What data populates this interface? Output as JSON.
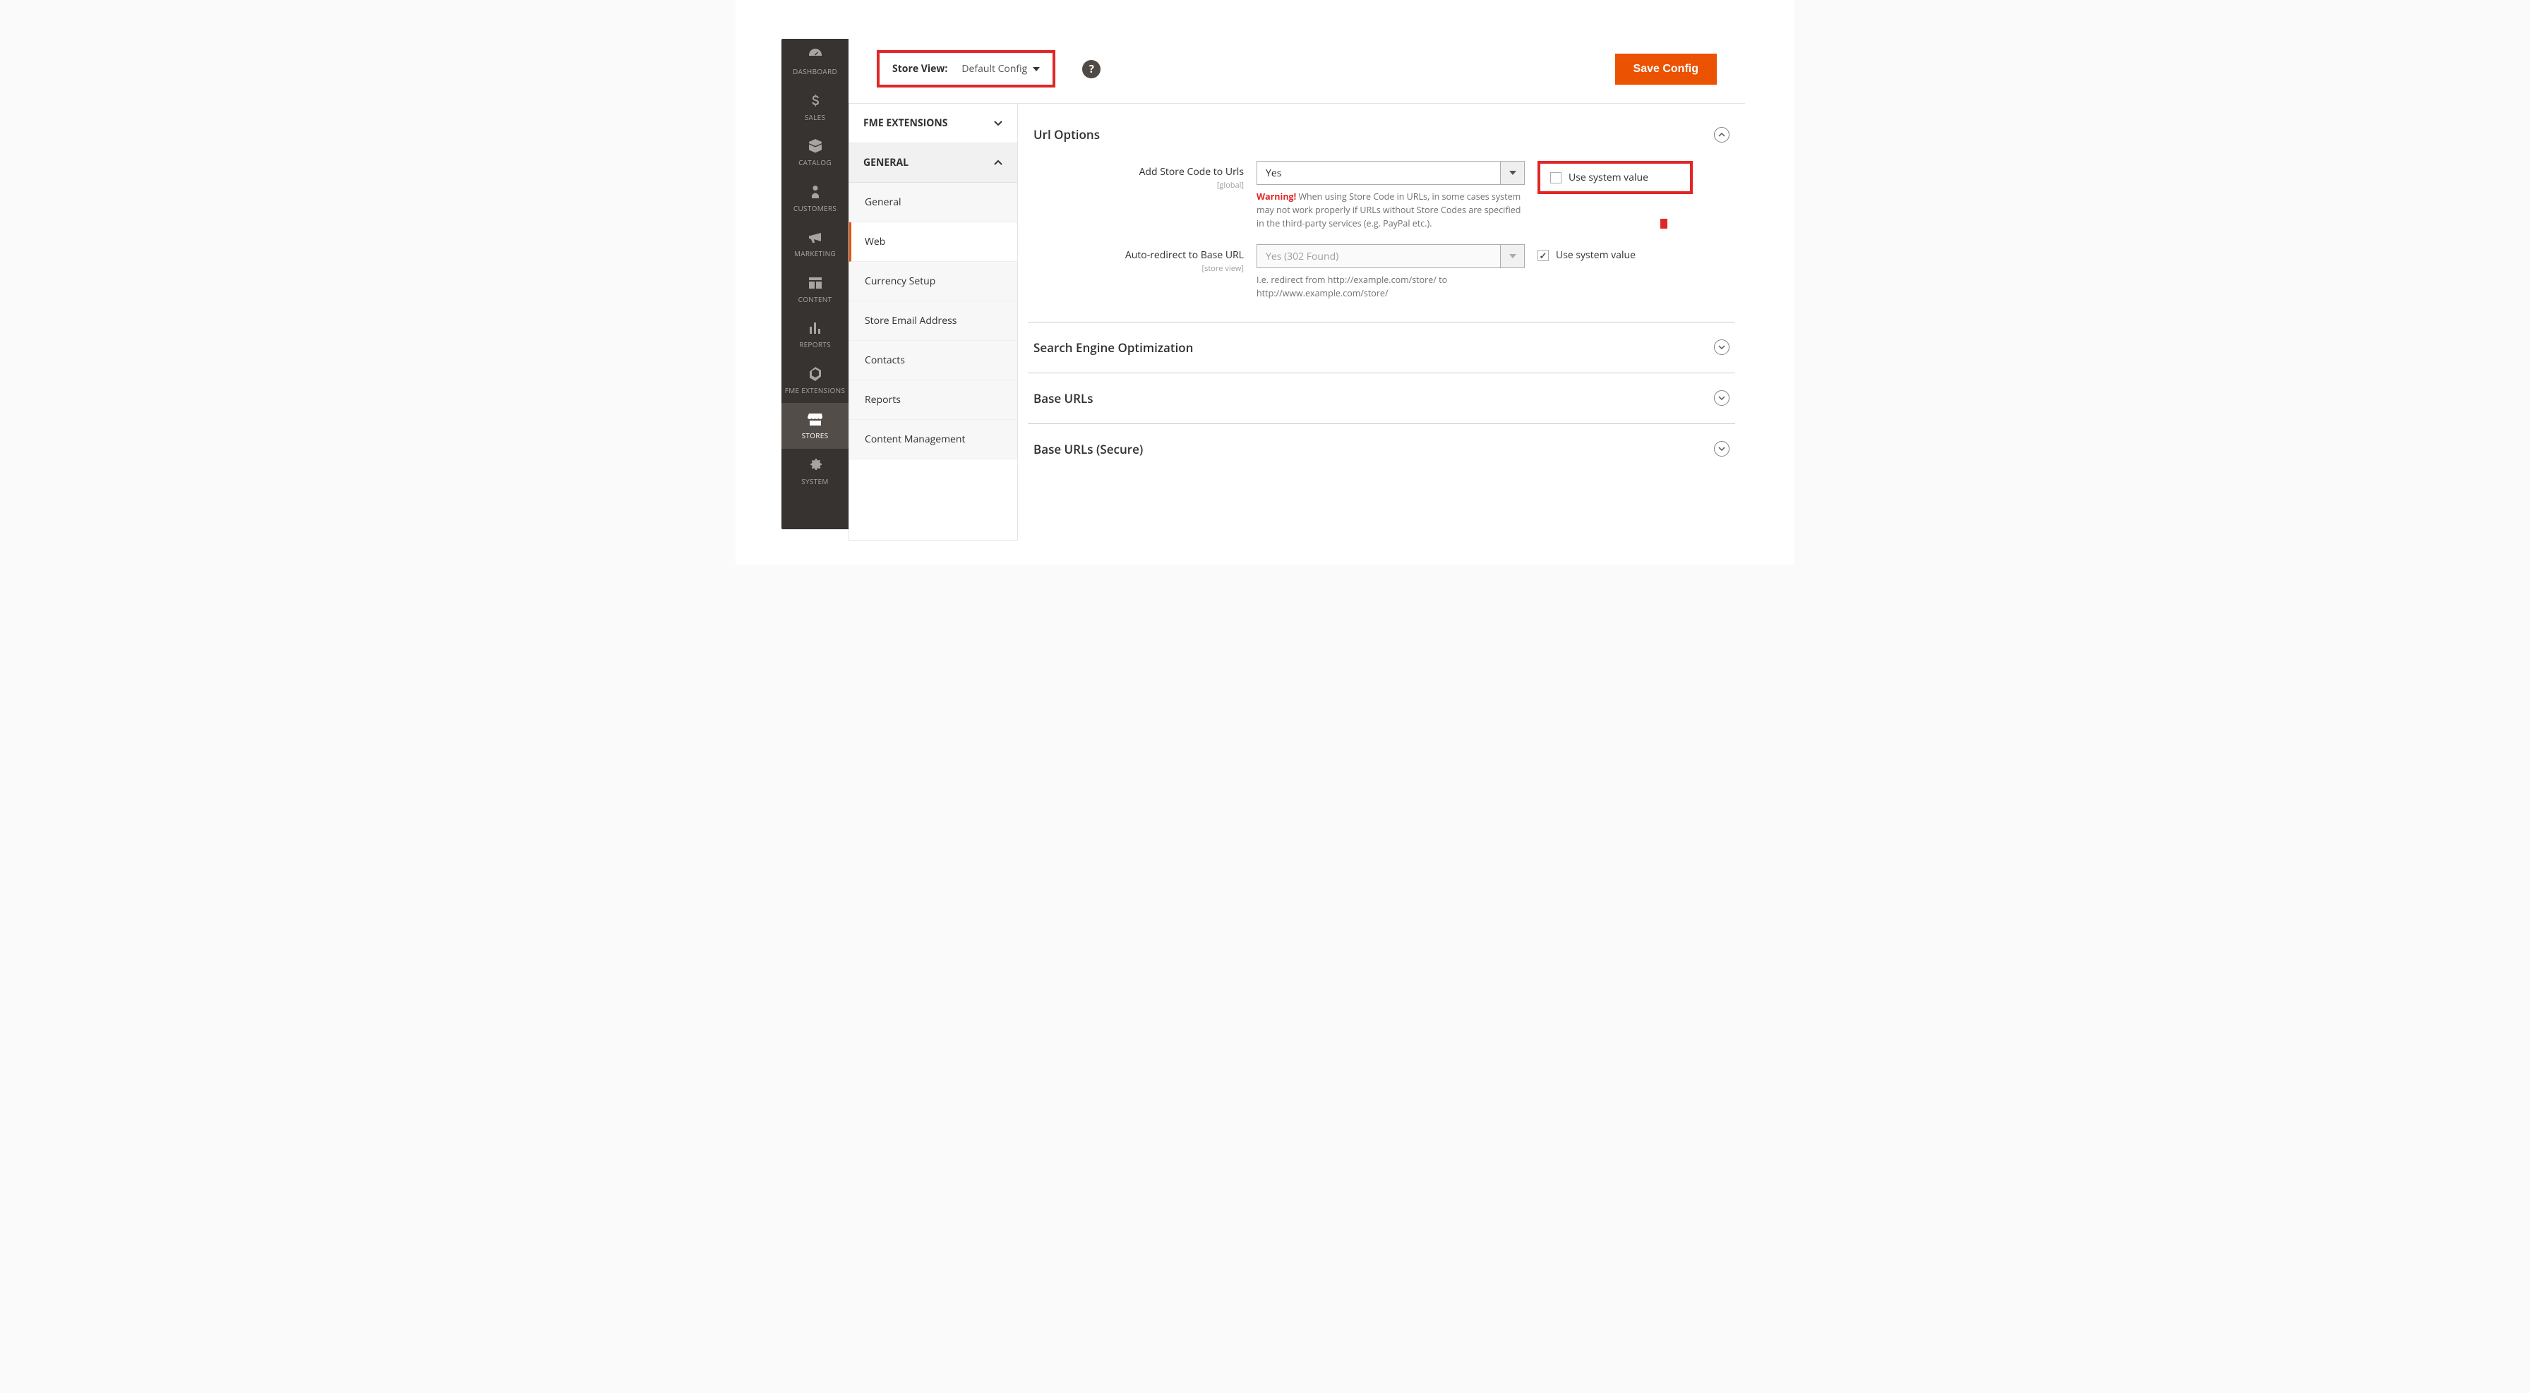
{
  "nav": [
    {
      "label": "DASHBOARD"
    },
    {
      "label": "SALES"
    },
    {
      "label": "CATALOG"
    },
    {
      "label": "CUSTOMERS"
    },
    {
      "label": "MARKETING"
    },
    {
      "label": "CONTENT"
    },
    {
      "label": "REPORTS"
    },
    {
      "label": "FME EXTENSIONS"
    },
    {
      "label": "STORES"
    },
    {
      "label": "SYSTEM"
    }
  ],
  "header": {
    "store_view_label": "Store View:",
    "store_view_value": "Default Config",
    "save_button": "Save Config"
  },
  "sidebar": {
    "sections": [
      {
        "label": "FME EXTENSIONS",
        "expanded": false
      },
      {
        "label": "GENERAL",
        "expanded": true
      }
    ],
    "subs": [
      {
        "label": "General"
      },
      {
        "label": "Web",
        "active": true
      },
      {
        "label": "Currency Setup"
      },
      {
        "label": "Store Email Address"
      },
      {
        "label": "Contacts"
      },
      {
        "label": "Reports"
      },
      {
        "label": "Content Management"
      }
    ]
  },
  "content": {
    "url_options": {
      "title": "Url Options",
      "add_store_code": {
        "label": "Add Store Code to Urls",
        "scope": "[global]",
        "value": "Yes",
        "use_system": "Use system value",
        "warning_word": "Warning!",
        "warning_text": " When using Store Code in URLs, in some cases system may not work properly if URLs without Store Codes are specified in the third-party services (e.g. PayPal etc.)."
      },
      "auto_redirect": {
        "label": "Auto-redirect to Base URL",
        "scope": "[store view]",
        "value": "Yes (302 Found)",
        "use_system": "Use system value",
        "note": "I.e. redirect from http://example.com/store/ to http://www.example.com/store/"
      }
    },
    "collapsed": [
      "Search Engine Optimization",
      "Base URLs",
      "Base URLs (Secure)"
    ]
  }
}
